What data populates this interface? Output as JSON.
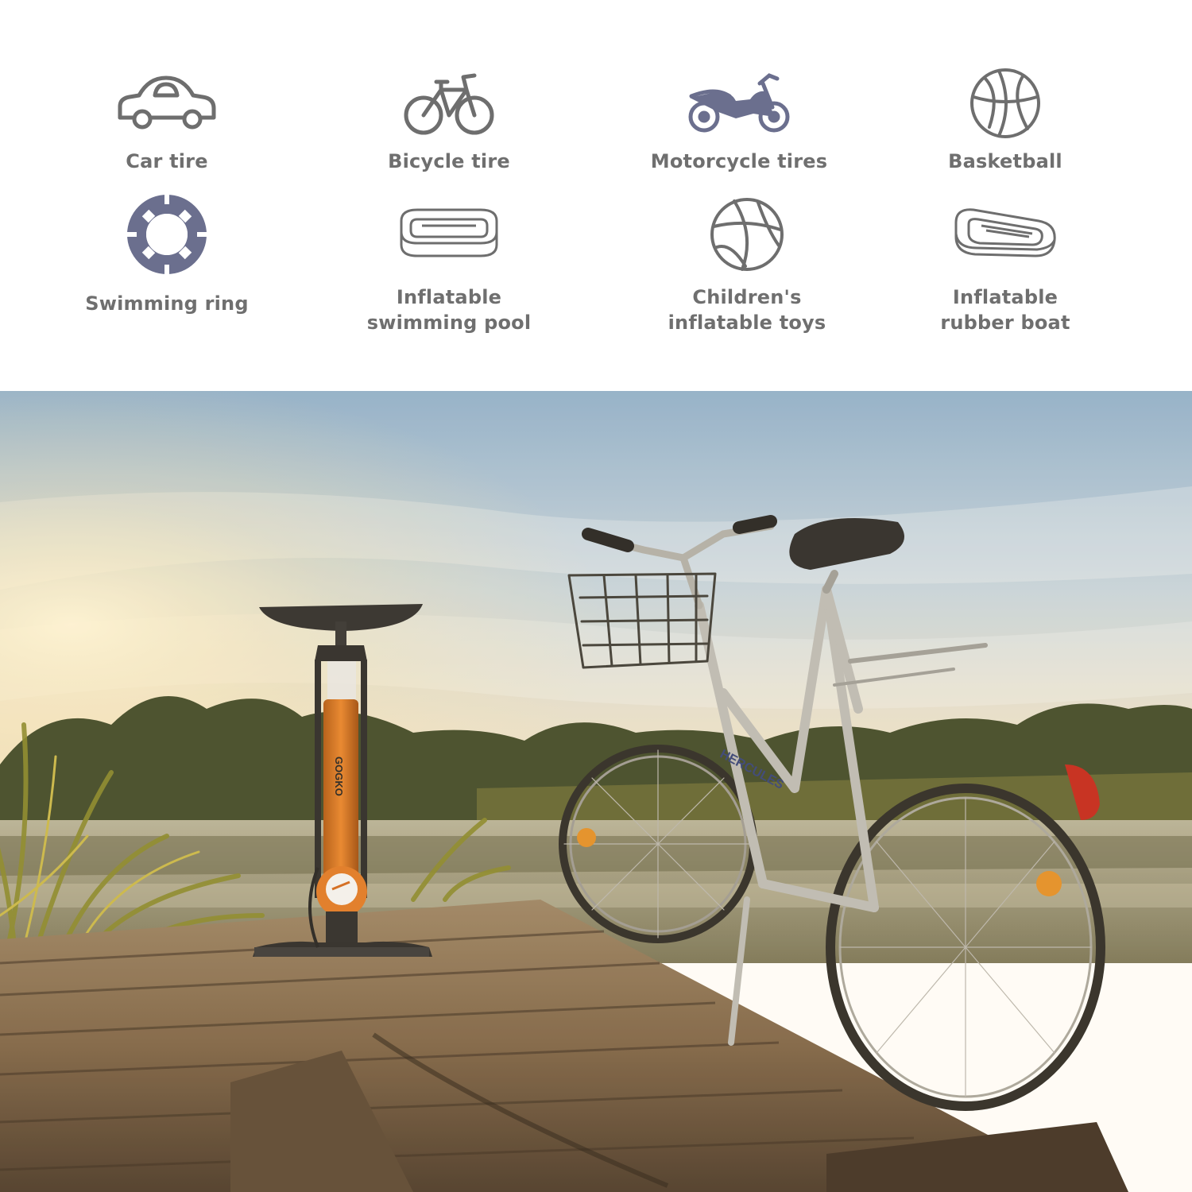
{
  "usage_items": [
    {
      "icon": "car-icon",
      "label_lines": [
        "Car tire"
      ]
    },
    {
      "icon": "bicycle-icon",
      "label_lines": [
        "Bicycle tire"
      ]
    },
    {
      "icon": "motorcycle-icon",
      "label_lines": [
        "Motorcycle tires"
      ]
    },
    {
      "icon": "basketball-icon",
      "label_lines": [
        "Basketball"
      ]
    },
    {
      "icon": "swimming-ring-icon",
      "label_lines": [
        "Swimming ring"
      ]
    },
    {
      "icon": "inflatable-pool-icon",
      "label_lines": [
        "Inflatable",
        "swimming pool"
      ]
    },
    {
      "icon": "beach-ball-icon",
      "label_lines": [
        "Children's",
        "inflatable toys"
      ]
    },
    {
      "icon": "rubber-boat-icon",
      "label_lines": [
        "Inflatable",
        "rubber boat"
      ]
    }
  ],
  "photo": {
    "pump_brand": "GOGKO",
    "bicycle_brand": "HERCULES"
  },
  "colors": {
    "icon_stroke": "#6e6e6e",
    "icon_accent": "#6b6f8e",
    "label": "#6f6f6f",
    "pump_orange": "#d9731f"
  }
}
